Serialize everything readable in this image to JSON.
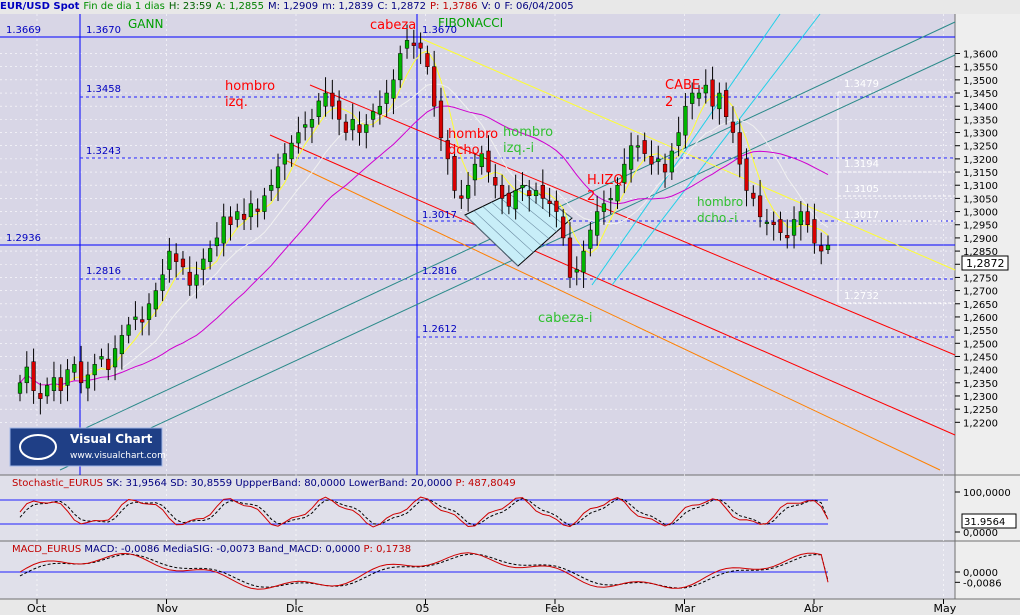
{
  "header": {
    "symbol": "EUR/USD Spot",
    "period": "Fin de dia 1 dias",
    "hour": "H: 23:59",
    "open": "A: 1,2855",
    "high": "M: 1,2909",
    "low": "m: 1,2839",
    "close": "C: 1,2872",
    "points": "P: 1,3786",
    "volume": "V: 0",
    "date": "F: 06/04/2005"
  },
  "stoch_header": {
    "name": "Stochastic_EURUS",
    "sk": "SK: 31,9564",
    "sd": "SD: 30,8559",
    "upper": "UppperBand: 80,0000",
    "lower": "LowerBand: 20,0000",
    "p": "P: 487,8049"
  },
  "macd_header": {
    "name": "MACD_EURUS",
    "macd": "MACD: -0,0086",
    "signal": "MediaSIG: -0,0073",
    "band": "Band_MACD: 0,0000",
    "p": "P: 0,1738"
  },
  "logo": {
    "title": "Visual Chart",
    "url": "www.visualchart.com"
  },
  "colors": {
    "plot_bg": "#d8d6e6",
    "grid": "#ffffff",
    "up": "#00b400",
    "down": "#d80000",
    "gann": "#0000ff",
    "fib": "#2020ff",
    "sma_yellow": "#ffff30",
    "sma_white": "#f0f0f0",
    "sma_magenta": "#d000d0",
    "channel_red": "#ff0000",
    "channel_orange": "#ff8000",
    "channel_teal": "#2b8a8a",
    "trend_cyan": "#20d0e8"
  },
  "chart_data": {
    "type": "candlestick",
    "x_labels": [
      "Oct",
      "Nov",
      "Dic",
      "05",
      "Feb",
      "Mar",
      "Abr",
      "May"
    ],
    "y_axis": {
      "min": 1.2,
      "max": 1.375,
      "ticks": [
        "1,2200",
        "1,2250",
        "1,2300",
        "1,2350",
        "1,2400",
        "1,2450",
        "1,2500",
        "1,2550",
        "1,2600",
        "1,2650",
        "1,2700",
        "1,2750",
        "1,2800",
        "1,2850",
        "1,2900",
        "1,2950",
        "1,3000",
        "1,3050",
        "1,3100",
        "1,3150",
        "1,3200",
        "1,3250",
        "1,3300",
        "1,3350",
        "1,3400",
        "1,3450",
        "1,3500",
        "1,3550",
        "1,3600"
      ],
      "last_price": "1,2872"
    },
    "last_bar": {
      "open": 1.2855,
      "high": 1.2909,
      "low": 1.2839,
      "close": 1.2872,
      "date": "06/04/2005"
    },
    "closes": [
      1.235,
      1.241,
      1.232,
      1.229,
      1.234,
      1.237,
      1.232,
      1.24,
      1.242,
      1.235,
      1.238,
      1.242,
      1.245,
      1.24,
      1.248,
      1.253,
      1.257,
      1.26,
      1.258,
      1.265,
      1.27,
      1.276,
      1.285,
      1.281,
      1.279,
      1.272,
      1.276,
      1.282,
      1.286,
      1.29,
      1.298,
      1.295,
      1.3,
      1.297,
      1.303,
      1.3,
      1.306,
      1.31,
      1.317,
      1.322,
      1.326,
      1.33,
      1.333,
      1.335,
      1.342,
      1.345,
      1.34,
      1.335,
      1.33,
      1.335,
      1.33,
      1.333,
      1.338,
      1.34,
      1.345,
      1.35,
      1.36,
      1.365,
      1.363,
      1.362,
      1.355,
      1.34,
      1.328,
      1.32,
      1.308,
      1.305,
      1.31,
      1.318,
      1.322,
      1.315,
      1.31,
      1.305,
      1.302,
      1.308,
      1.31,
      1.306,
      1.308,
      1.305,
      1.303,
      1.3,
      1.29,
      1.275,
      1.278,
      1.285,
      1.293,
      1.3,
      1.303,
      1.305,
      1.31,
      1.318,
      1.325,
      1.325,
      1.322,
      1.318,
      1.32,
      1.315,
      1.323,
      1.33,
      1.34,
      1.345,
      1.345,
      1.348,
      1.34,
      1.345,
      1.336,
      1.33,
      1.318,
      1.308,
      1.305,
      1.298,
      1.296,
      1.295,
      1.292,
      1.29,
      1.297,
      1.3,
      1.295,
      1.288,
      1.285,
      1.2872
    ],
    "stochastic": {
      "sk": 31.9564,
      "sd": 30.8559,
      "upper_band": 80,
      "lower_band": 20,
      "ticks": [
        "100,0000",
        "0,0000"
      ]
    },
    "macd": {
      "macd": -0.0086,
      "signal": -0.0073,
      "band": 0,
      "ticks": [
        "0,0000",
        "-0,0086"
      ]
    },
    "fibonacci_left": [
      "1.3669",
      "1.3670",
      "1.3458",
      "1.3243",
      "1.2936",
      "1.2816"
    ],
    "fibonacci_mid": [
      "1.3670",
      "1.3017",
      "1.2816",
      "1.2612"
    ],
    "fibonacci_right": [
      "1.3479",
      "1.3194",
      "1.3105",
      "1.3017",
      "1.2732"
    ],
    "annotations": {
      "gann": "GANN",
      "fibonacci": "FIBONACCI",
      "cabeza": "cabeza",
      "hombro_izq_1": "hombro",
      "hombro_izq_2": "izq.",
      "hombro_dcho_1": "hombro",
      "hombro_dcho_2": "dcho.",
      "hombro_izqi_1": "hombro",
      "hombro_izqi_2": "izq.-i",
      "hizq_1": "H.IZQ.",
      "hizq_2": "2",
      "cabe2_1": "CABE.",
      "cabe2_2": "2",
      "hombro_dchoi_1": "hombro",
      "hombro_dchoi_2": "dcho.-i",
      "cabeza_i": "cabeza-i"
    }
  }
}
